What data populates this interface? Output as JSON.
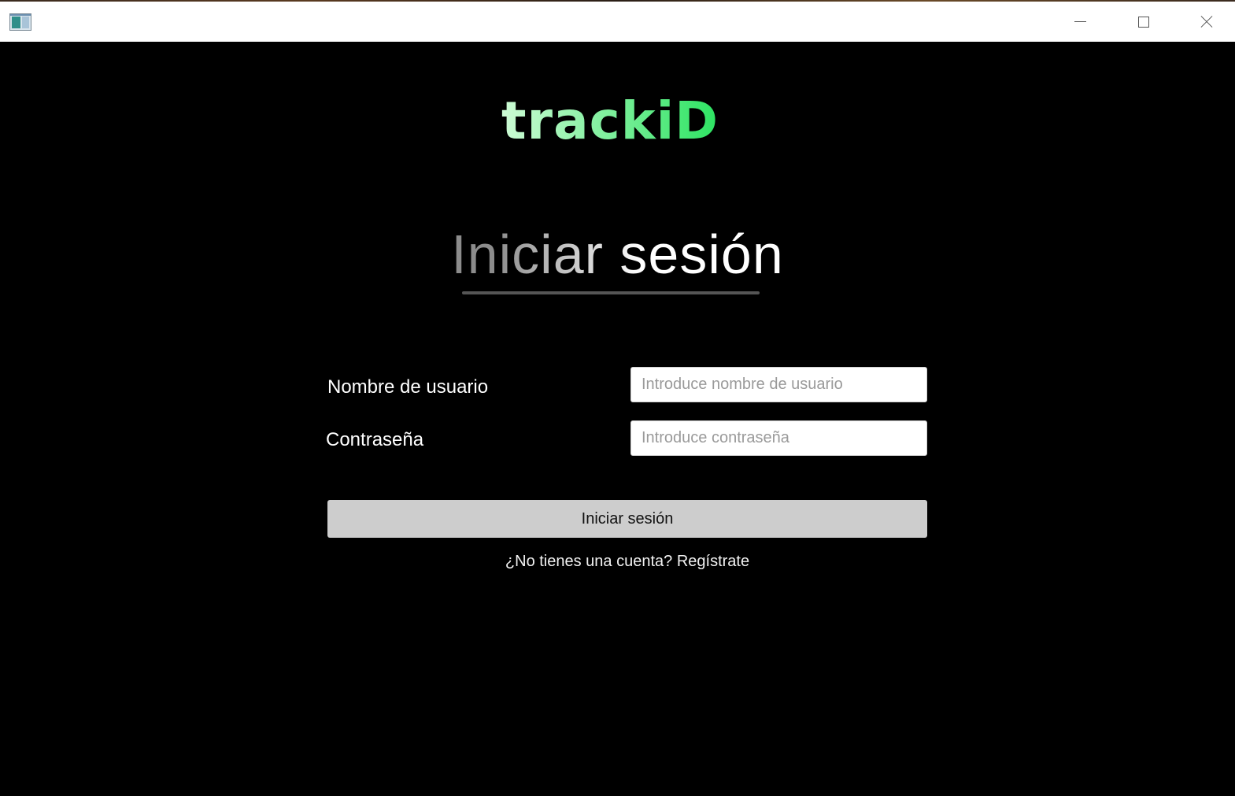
{
  "titlebar": {
    "icon": "app-window-icon",
    "controls": {
      "minimize_icon": "minimize-icon",
      "maximize_icon": "maximize-icon",
      "close_icon": "close-icon"
    }
  },
  "logo": {
    "text": "trackiD",
    "colors": {
      "light": "#e9ffe9",
      "green": "#0fdc4a"
    }
  },
  "heading": {
    "text": "Iniciar sesión"
  },
  "form": {
    "username": {
      "label": "Nombre de usuario",
      "value": "",
      "placeholder": "Introduce nombre de usuario"
    },
    "password": {
      "label": "Contraseña",
      "value": "",
      "placeholder": "Introduce contraseña"
    },
    "submit_label": "Iniciar sesión",
    "register_link": "¿No tienes una cuenta? Regístrate"
  },
  "colors": {
    "background": "#000000",
    "button": "#cdcdcd",
    "underline": "#555555"
  }
}
